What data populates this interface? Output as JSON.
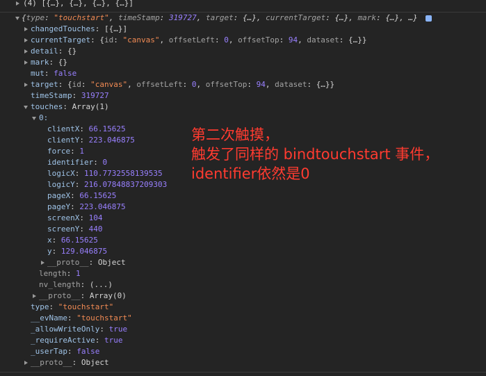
{
  "console": {
    "array_summary": "(4) [{…}, {…}, {…}, {…}]",
    "object_preview": {
      "open": "{",
      "type_key": "type",
      "type_val": "\"touchstart\"",
      "ts_key": "timeStamp",
      "ts_val": "319727",
      "target_key": "target",
      "target_val": "{…}",
      "ct_key": "currentTarget",
      "ct_val": "{…}",
      "mark_key": "mark",
      "mark_val": "{…}",
      "rest": "…}"
    },
    "changedTouches": {
      "key": "changedTouches",
      "val": "[{…}]"
    },
    "currentTarget": {
      "key": "currentTarget",
      "open": "{",
      "id_key": "id",
      "id_val": "\"canvas\"",
      "ol_key": "offsetLeft",
      "ol_val": "0",
      "ot_key": "offsetTop",
      "ot_val": "94",
      "ds_key": "dataset",
      "ds_val": "{…}}"
    },
    "detail": {
      "key": "detail",
      "val": "{}"
    },
    "mark": {
      "key": "mark",
      "val": "{}"
    },
    "mut": {
      "key": "mut",
      "val": "false"
    },
    "target": {
      "key": "target",
      "open": "{",
      "id_key": "id",
      "id_val": "\"canvas\"",
      "ol_key": "offsetLeft",
      "ol_val": "0",
      "ot_key": "offsetTop",
      "ot_val": "94",
      "ds_key": "dataset",
      "ds_val": "{…}}"
    },
    "timeStamp": {
      "key": "timeStamp",
      "val": "319727"
    },
    "touches": {
      "key": "touches",
      "val": "Array(1)"
    },
    "touch0": {
      "index": "0:",
      "props": [
        {
          "key": "clientX",
          "val": "66.15625"
        },
        {
          "key": "clientY",
          "val": "223.046875"
        },
        {
          "key": "force",
          "val": "1"
        },
        {
          "key": "identifier",
          "val": "0"
        },
        {
          "key": "logicX",
          "val": "110.7732558139535"
        },
        {
          "key": "logicY",
          "val": "216.07848837209303"
        },
        {
          "key": "pageX",
          "val": "66.15625"
        },
        {
          "key": "pageY",
          "val": "223.046875"
        },
        {
          "key": "screenX",
          "val": "104"
        },
        {
          "key": "screenY",
          "val": "440"
        },
        {
          "key": "x",
          "val": "66.15625"
        },
        {
          "key": "y",
          "val": "129.046875"
        }
      ],
      "proto_key": "__proto__",
      "proto_val": "Object"
    },
    "length": {
      "key": "length",
      "val": "1"
    },
    "nv_length": {
      "key": "nv_length",
      "val": "(...)"
    },
    "touches_proto": {
      "key": "__proto__",
      "val": "Array(0)"
    },
    "type": {
      "key": "type",
      "val": "\"touchstart\""
    },
    "evName": {
      "key": "__evName",
      "val": "\"touchstart\""
    },
    "allowWriteOnly": {
      "key": "_allowWriteOnly",
      "val": "true"
    },
    "requireActive": {
      "key": "_requireActive",
      "val": "true"
    },
    "userTap": {
      "key": "_userTap",
      "val": "false"
    },
    "root_proto": {
      "key": "__proto__",
      "val": "Object"
    }
  },
  "annotation": {
    "line1": "第二次触摸，",
    "line2": "触发了同样的 bindtouchstart 事件，",
    "line3": "identifier依然是0"
  },
  "colors": {
    "background": "#242424",
    "key": "#9fc3e7",
    "string": "#f28b54",
    "number": "#9980ff",
    "annotation": "#ff3b30"
  }
}
